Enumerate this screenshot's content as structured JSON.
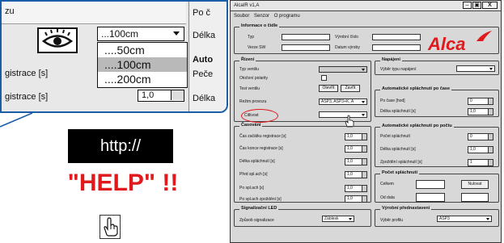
{
  "zoom": {
    "row1_label": "zu",
    "right_labels": [
      "Po č",
      "Délka",
      "Auto",
      "Peče",
      "Délka"
    ],
    "combo_value": "...100cm",
    "dropdown_options": [
      "....50cm",
      "....100cm",
      "....200cm"
    ],
    "selected_option": "....100cm",
    "row_label_a": "gistrace [s]",
    "row_label_b": "gistrace [s]",
    "spin_value": "1,0"
  },
  "http_text": "http://",
  "help_text": "\"HELP\" !!",
  "window": {
    "title": "AlcaIR v1,A",
    "controls": [
      "–",
      "▣",
      "X"
    ],
    "menu": [
      "Soubor",
      "Senzor",
      "O programu"
    ],
    "info": {
      "title": "Informace o čidle",
      "typ": "Typ",
      "vyrobni_cislo": "Výrobní číslo",
      "verze_sw": "Verze SW",
      "datum_vyroby": "Datum výroby",
      "logo": "Alca"
    },
    "rizeni": {
      "title": "Řízení",
      "typ_ventilu": "Typ ventilu",
      "otoceni": "Otočení polarity",
      "test_ventilu": "Test ventilu",
      "otevrit": "Otevřít",
      "zavrit": "Zavřít",
      "rezim": "Režim provozu",
      "rezim_value": "ASP3, ASP3+K, A",
      "citlivost": "Citlivost"
    },
    "napajeni": {
      "title": "Napájení",
      "label": "Výběr typu napájení"
    },
    "po_case": {
      "title": "Automatické spláchnutí po čase",
      "po_case": "Po čase [hod]",
      "po_case_value": "0",
      "delka": "Délka spláchnutí [s]",
      "delka_value": "1,0"
    },
    "casovani": {
      "title": "Časování",
      "rows": [
        {
          "label": "Čas začátku registrace [s]",
          "value": "1,0"
        },
        {
          "label": "Čas konce registrace [s]",
          "value": "1,0"
        },
        {
          "label": "Délka spláchnutí [s]",
          "value": "1,0"
        },
        {
          "label": "Před spl.ach [s]",
          "value": "1,0"
        },
        {
          "label": "Po spl.ach [s]",
          "value": "1,0"
        },
        {
          "label": "Po spl.ach zpoždění [s]",
          "value": "1,0"
        }
      ]
    },
    "po_poctu": {
      "title": "Automatické spláchnutí po počtu",
      "rows": [
        {
          "label": "Počet spláchnutí",
          "value": "0"
        },
        {
          "label": "Délka spláchnutí [s]",
          "value": "1,0"
        },
        {
          "label": "Zpoždění spláchnutí [s]",
          "value": "1"
        }
      ]
    },
    "pocet": {
      "title": "Počet spláchnutí",
      "celkem": "Celkem",
      "nulovat": "Nulovat",
      "od_data": "Od data"
    },
    "led": {
      "title": "Signalizační LED",
      "label": "Způsob signalizace",
      "value": "Záblesk"
    },
    "prednast": {
      "title": "Výrobní přednastavení",
      "label": "Výběr profilu",
      "value": "ASP3"
    }
  },
  "colors": {
    "accent": "#1a5ea8",
    "alert": "#e0191d"
  }
}
